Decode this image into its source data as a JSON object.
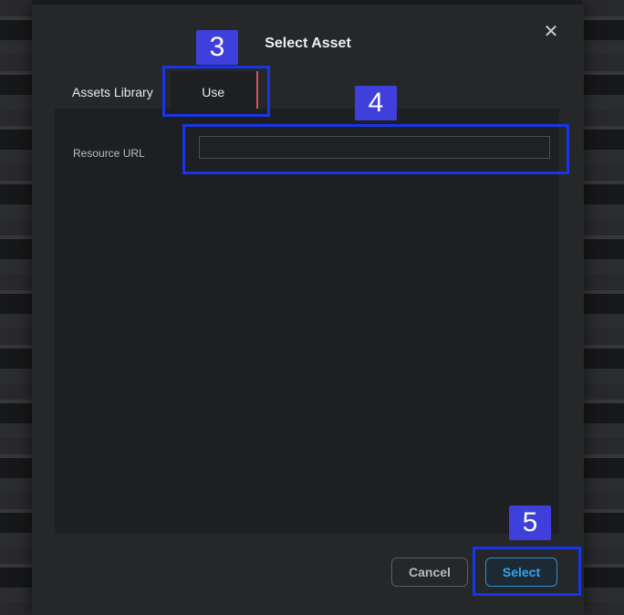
{
  "dialog": {
    "title": "Select Asset",
    "close_glyph": "✕"
  },
  "tabs": [
    {
      "label": "Assets Library"
    },
    {
      "label": "Use URL"
    }
  ],
  "form": {
    "resource_url_label": "Resource URL",
    "resource_url_value": ""
  },
  "buttons": {
    "cancel": "Cancel",
    "select": "Select"
  },
  "annotations": {
    "badge_3": "3",
    "badge_4": "4",
    "badge_5": "5"
  },
  "colors": {
    "highlight": "#1836e8",
    "badge": "#3f3fdc",
    "select_accent": "#34a4f0"
  }
}
